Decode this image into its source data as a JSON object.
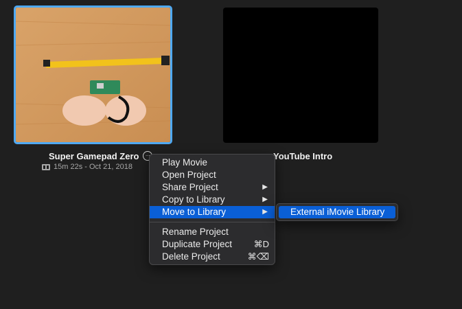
{
  "projects": [
    {
      "title": "Super Gamepad Zero",
      "meta": "15m 22s - Oct 21, 2018",
      "selected": true
    },
    {
      "title": "YouTube Intro",
      "meta": ""
    }
  ],
  "context_menu": {
    "items": [
      {
        "label": "Play Movie"
      },
      {
        "label": "Open Project"
      },
      {
        "label": "Share Project",
        "submenu": true
      },
      {
        "label": "Copy to Library",
        "submenu": true
      },
      {
        "label": "Move to Library",
        "submenu": true,
        "highlighted": true
      },
      {
        "label": "Rename Project"
      },
      {
        "label": "Duplicate Project",
        "shortcut": "⌘D"
      },
      {
        "label": "Delete Project",
        "shortcut": "⌘⌫"
      }
    ]
  },
  "submenu": {
    "items": [
      {
        "label": "External iMovie Library",
        "highlighted": true
      }
    ]
  },
  "colors": {
    "background": "#1f1f1f",
    "selection_border": "#4fa9f3",
    "menu_highlight": "#0a5fd6",
    "menu_background": "#2c2c2e"
  },
  "icons": {
    "submenu_arrow": "▶",
    "options": "ellipsis-circle-icon",
    "film": "film-icon"
  }
}
